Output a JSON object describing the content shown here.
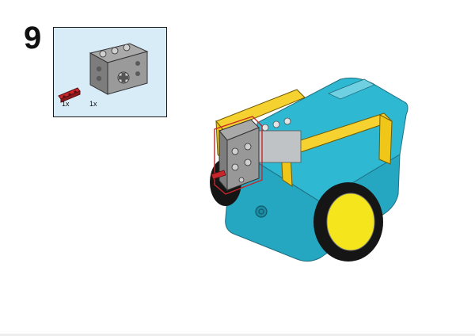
{
  "step": {
    "number": "9"
  },
  "parts": {
    "items": [
      {
        "name": "axle-connector",
        "qty": "1x",
        "color": "#c8262a"
      },
      {
        "name": "motor",
        "qty": "1x",
        "color": "#8a8a8a"
      }
    ],
    "background_color": "#d8ecf8"
  },
  "model": {
    "body_color": "#2cb8d2",
    "frame_color": "#f6d230",
    "wheel_color": "#f4e51c",
    "tire_color": "#111111",
    "highlight_color": "#c8262a"
  }
}
